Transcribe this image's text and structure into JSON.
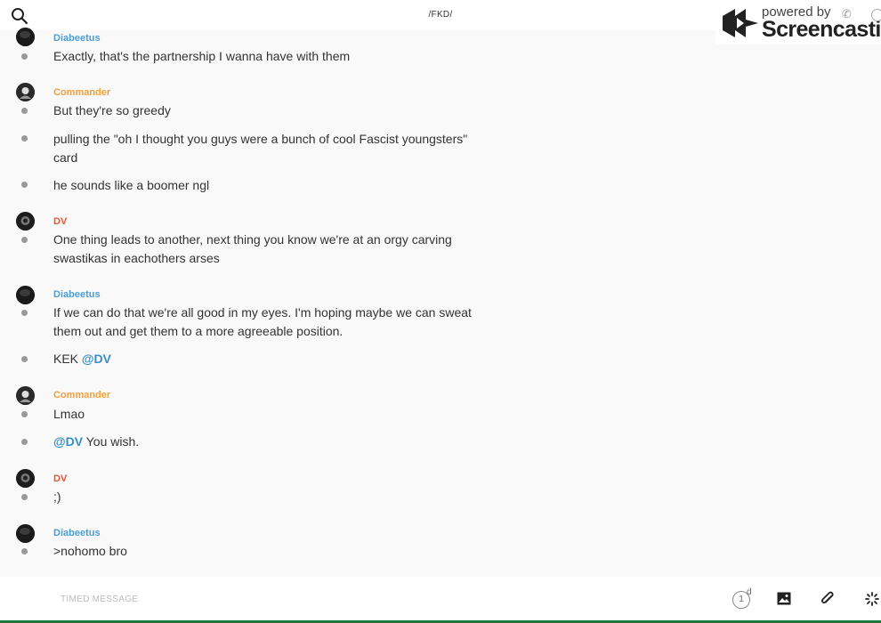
{
  "header": {
    "channel": "/FKD/"
  },
  "watermark": {
    "powered": "powered by",
    "brand": "Screencastify"
  },
  "messages": [
    {
      "user": "Diabeetus",
      "text": "Exactly, that's the partnership I wanna have with them"
    },
    {
      "user": "Commander",
      "text": "But they're so greedy"
    },
    {
      "text": "pulling the \"oh I thought you guys were a bunch of cool Fascist youngsters\" card"
    },
    {
      "text": "he sounds like a boomer ngl"
    },
    {
      "user": "DV",
      "text": "One thing leads to another, next thing you know we're at an orgy carving swastikas in eachothers arses"
    },
    {
      "user": "Diabeetus",
      "text": "If we can do that we're all good in my eyes. I'm hoping maybe we can sweat them out and get them to a more agreeable position."
    },
    {
      "text": "KEK ",
      "mention": "@DV"
    },
    {
      "user": "Commander",
      "text": "Lmao"
    },
    {
      "mention": "@DV",
      "text": " You wish."
    },
    {
      "user": "DV",
      "text": ";)"
    },
    {
      "user": "Diabeetus",
      "text": ">nohomo bro"
    }
  ],
  "composer": {
    "timed_label": "TIMED MESSAGE",
    "timer_value": "1",
    "timer_unit": "d"
  },
  "icons": {
    "search": "search-icon",
    "image": "image-icon",
    "attach": "paperclip-icon",
    "more": "sparkle-icon"
  }
}
